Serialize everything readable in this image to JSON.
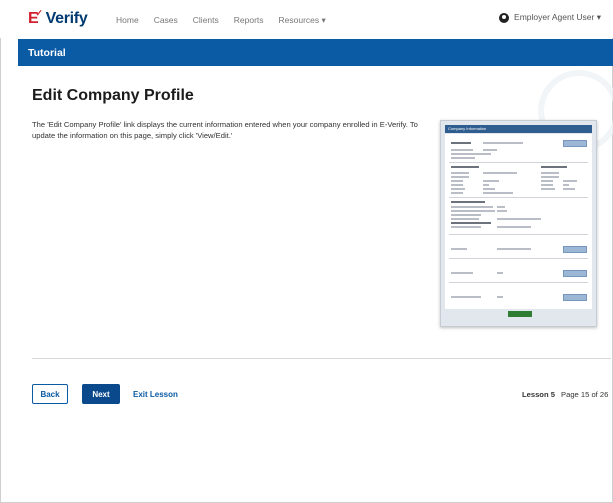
{
  "app": {
    "logo_text": "Verify",
    "logo_prefix": "E"
  },
  "nav": {
    "items": [
      "Home",
      "Cases",
      "Clients",
      "Reports",
      "Resources ▾"
    ]
  },
  "user": {
    "label": "Employer Agent User ▾"
  },
  "band": {
    "title": "Tutorial"
  },
  "content": {
    "title": "Edit Company Profile",
    "description": "The 'Edit Company Profile' link displays the current information entered when your company enrolled in E-Verify. To update the information on this page, simply click 'View/Edit.'"
  },
  "thumbnail": {
    "header": "Company Information"
  },
  "footer": {
    "back_label": "Back",
    "next_label": "Next",
    "exit_label": "Exit Lesson",
    "lesson_label": "Lesson 5",
    "page_label": "Page 15 of 26"
  },
  "colors": {
    "brand_blue": "#0a5aa4",
    "logo_red": "#d0202e",
    "next_button": "#0a4a8c"
  }
}
